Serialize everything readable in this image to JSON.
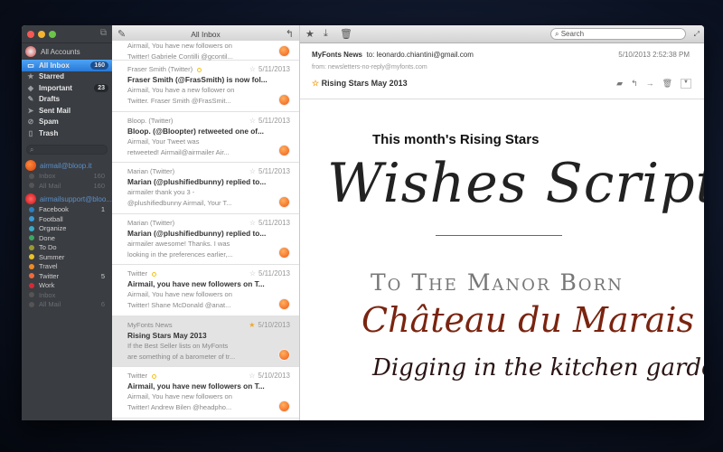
{
  "sidebar": {
    "all_accounts": "All Accounts",
    "nav": [
      {
        "label": "All Inbox",
        "badge": "160",
        "icon": "inbox-icon"
      },
      {
        "label": "Starred",
        "icon": "star-icon"
      },
      {
        "label": "Important",
        "badge": "23",
        "icon": "tag-icon"
      },
      {
        "label": "Drafts",
        "icon": "pencil-icon"
      },
      {
        "label": "Sent Mail",
        "icon": "send-icon"
      },
      {
        "label": "Spam",
        "icon": "spam-icon"
      },
      {
        "label": "Trash",
        "icon": "trash-icon"
      }
    ],
    "account1": {
      "email": "airmail@bloop.it",
      "folders": [
        {
          "label": "Inbox",
          "count": "160"
        },
        {
          "label": "All Mail",
          "count": "160"
        }
      ]
    },
    "account2": {
      "email": "airmailsupport@bloo...",
      "labels": [
        {
          "label": "Facebook",
          "count": "1",
          "color": "#2a7fc0"
        },
        {
          "label": "Football",
          "color": "#3a9ad6"
        },
        {
          "label": "Organize",
          "color": "#3aaac8"
        },
        {
          "label": "Done",
          "color": "#3aa860"
        },
        {
          "label": "To Do",
          "color": "#9a9a30"
        },
        {
          "label": "Summer",
          "color": "#e8c22a"
        },
        {
          "label": "Travel",
          "color": "#f08a24"
        },
        {
          "label": "Twitter",
          "count": "5",
          "color": "#f06a3a"
        },
        {
          "label": "Work",
          "color": "#d42a36"
        }
      ],
      "folders": [
        {
          "label": "Inbox"
        },
        {
          "label": "All Mail",
          "count": "6"
        }
      ]
    }
  },
  "list": {
    "title": "All Inbox",
    "partial": {
      "preview1": "Airmail, You have new followers on",
      "preview2": "Twitter!    Gabriele Contilli @gcontil..."
    },
    "items": [
      {
        "from": "Fraser Smith (Twitter)",
        "unread": true,
        "date": "5/11/2013",
        "starred": false,
        "subject": "Fraser Smith (@FrasSmith) is now fol...",
        "p1": "Airmail, You have a new follower on",
        "p2": "Twitter.    Fraser Smith @FrasSmit..."
      },
      {
        "from": "Bloop. (Twitter)",
        "unread": false,
        "date": "5/11/2013",
        "starred": false,
        "subject": "Bloop. (@Bloopter) retweeted one of...",
        "p1": "Airmail, Your Tweet was",
        "p2": "retweeted!    Airmail@airmailer Air..."
      },
      {
        "from": "Marian (Twitter)",
        "unread": false,
        "date": "5/11/2013",
        "starred": false,
        "subject": "Marian (@plushifiedbunny) replied to...",
        "p1": "airmailer thank you 3 -",
        "p2": "@plushifiedbunny    Airmail, Your T..."
      },
      {
        "from": "Marian (Twitter)",
        "unread": false,
        "date": "5/11/2013",
        "starred": false,
        "subject": "Marian (@plushifiedbunny) replied to...",
        "p1": "airmailer awesome! Thanks. I was",
        "p2": "looking in the preferences earlier,..."
      },
      {
        "from": "Twitter",
        "unread": true,
        "date": "5/11/2013",
        "starred": false,
        "subject": "Airmail, you have new followers on T...",
        "p1": "Airmail, You have new followers on",
        "p2": "Twitter!    Shane McDonald @anat..."
      },
      {
        "from": "MyFonts News",
        "unread": false,
        "date": "5/10/2013",
        "starred": true,
        "selected": true,
        "subject": "Rising Stars May 2013",
        "p1": "If the Best Seller lists on MyFonts",
        "p2": "are something of a barometer of tr..."
      },
      {
        "from": "Twitter",
        "unread": true,
        "date": "5/10/2013",
        "starred": false,
        "subject": "Airmail, you have new followers on T...",
        "p1": "Airmail, You have new followers on",
        "p2": "Twitter!    Andrew Bilen @headpho..."
      }
    ]
  },
  "reader": {
    "search_placeholder": "Search",
    "from": "MyFonts News",
    "to": "to: leonardo.chiantini@gmail.com",
    "sender": "from: newsletters-no-reply@myfonts.com",
    "date": "5/10/2013 2:52:38 PM",
    "subject": "Rising Stars May 2013",
    "body": {
      "heading": "This month's Rising Stars",
      "font1": "Wishes Script",
      "font2": "To The Manor Born",
      "font3": "Château du Marais",
      "font4": "Digging in the kitchen garden"
    }
  }
}
